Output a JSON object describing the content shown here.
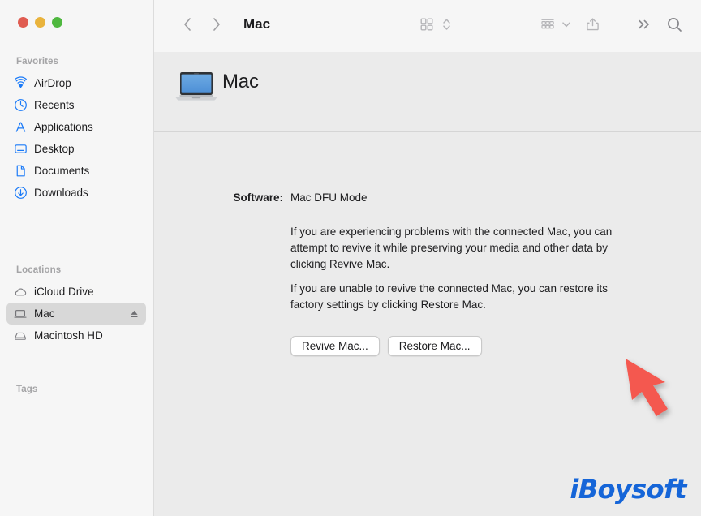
{
  "window": {
    "traffic_lights": [
      {
        "name": "close",
        "color": "#e05c51"
      },
      {
        "name": "minimize",
        "color": "#e9b33c"
      },
      {
        "name": "maximize",
        "color": "#4fb83f"
      }
    ]
  },
  "sidebar": {
    "sections": [
      {
        "header": "Favorites",
        "items": [
          {
            "label": "AirDrop",
            "icon": "airdrop-icon",
            "selected": false
          },
          {
            "label": "Recents",
            "icon": "clock-icon",
            "selected": false
          },
          {
            "label": "Applications",
            "icon": "applications-icon",
            "selected": false
          },
          {
            "label": "Desktop",
            "icon": "desktop-icon",
            "selected": false
          },
          {
            "label": "Documents",
            "icon": "document-icon",
            "selected": false
          },
          {
            "label": "Downloads",
            "icon": "download-icon",
            "selected": false
          }
        ]
      },
      {
        "header": "Locations",
        "items": [
          {
            "label": "iCloud Drive",
            "icon": "cloud-icon",
            "selected": false
          },
          {
            "label": "Mac",
            "icon": "laptop-icon",
            "selected": true,
            "eject": true
          },
          {
            "label": "Macintosh HD",
            "icon": "harddisk-icon",
            "selected": false
          }
        ]
      },
      {
        "header": "Tags",
        "items": []
      }
    ]
  },
  "toolbar": {
    "back_icon": "chevron-left-icon",
    "forward_icon": "chevron-right-icon",
    "title": "Mac",
    "view_icon": "grid-view-icon",
    "view_chevron_icon": "chevron-up-down-icon",
    "group_icon": "group-by-icon",
    "group_chevron_icon": "chevron-down-icon",
    "share_icon": "share-icon",
    "more_icon": "double-chevron-right-icon",
    "search_icon": "search-icon"
  },
  "item_header": {
    "icon": "macbook-icon",
    "title": "Mac"
  },
  "details": {
    "software_label": "Software:",
    "software_value": "Mac DFU Mode",
    "paragraph_1": "If you are experiencing problems with the connected Mac, you can attempt to revive it while preserving your media and other data by clicking Revive Mac.",
    "paragraph_2": "If you are unable to revive the connected Mac, you can restore its factory settings by clicking Restore Mac.",
    "revive_button": "Revive Mac...",
    "restore_button": "Restore Mac..."
  },
  "cursor": {
    "icon": "arrow-pointer-icon",
    "color": "#f4594f"
  },
  "branding": {
    "logo_text": "iBoysoft",
    "logo_color": "#1565d8"
  }
}
